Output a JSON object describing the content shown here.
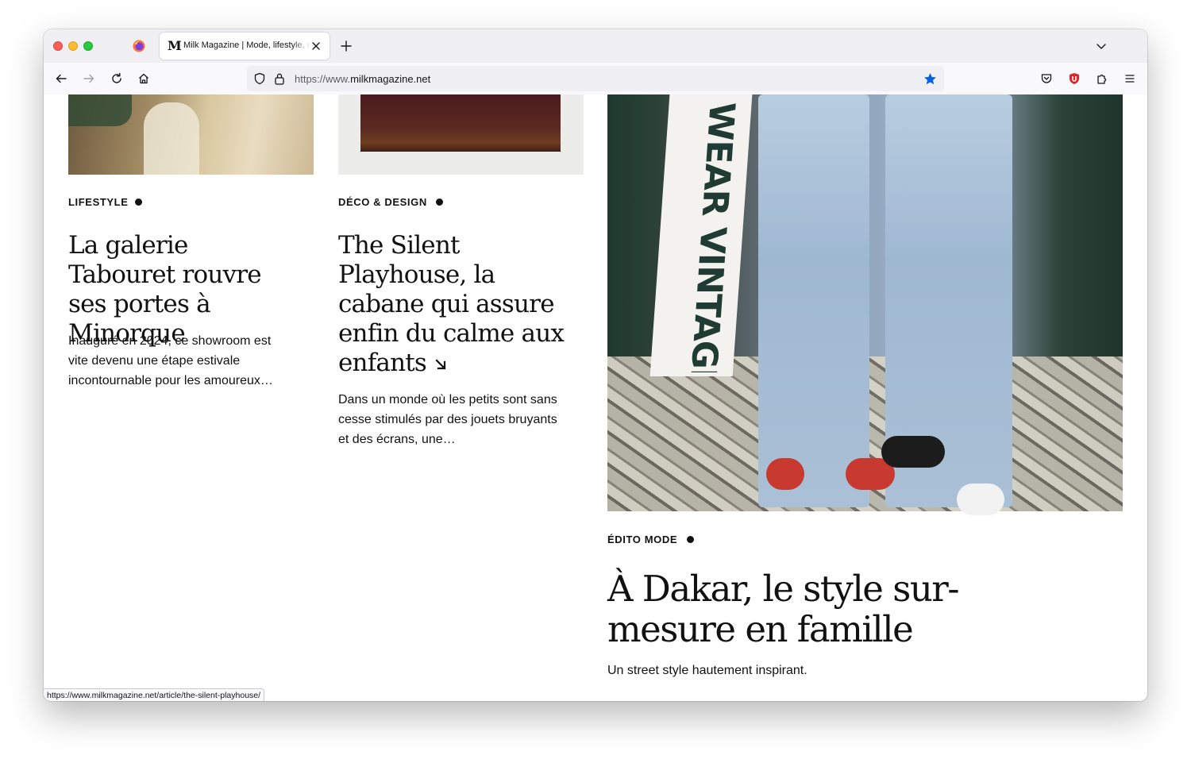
{
  "browser": {
    "tab": {
      "favicon_letter": "M",
      "title": "Milk Magazine | Mode, lifestyle, déco"
    },
    "url": {
      "scheme_prefix": "https://www.",
      "domain": "milkmagazine.net"
    },
    "bookmark_star_color": "#0060df",
    "status_url": "https://www.milkmagazine.net/article/the-silent-playhouse/"
  },
  "articles": [
    {
      "category": "LIFESTYLE",
      "title": "La galerie Tabouret rouvre ses portes à Minorque",
      "excerpt": "Inauguré en 2024, ce showroom est vite devenu une étape estivale incontournable pour les amoureux…"
    },
    {
      "category": "DÉCO & DESIGN",
      "title": "The Silent Playhouse, la cabane qui assure enfin du calme aux enfants",
      "excerpt": "Dans un monde où les petits sont sans cesse stimulés par des jouets bruyants et des écrans, une…"
    },
    {
      "category": "ÉDITO MODE",
      "title": "À Dakar, le style sur-mesure en famille",
      "excerpt": "Un street style hautement inspirant.",
      "image_sign_text": "WEAR VINTAGE"
    }
  ],
  "colors": {
    "text": "#111111",
    "ublock_red": "#e0222b"
  }
}
